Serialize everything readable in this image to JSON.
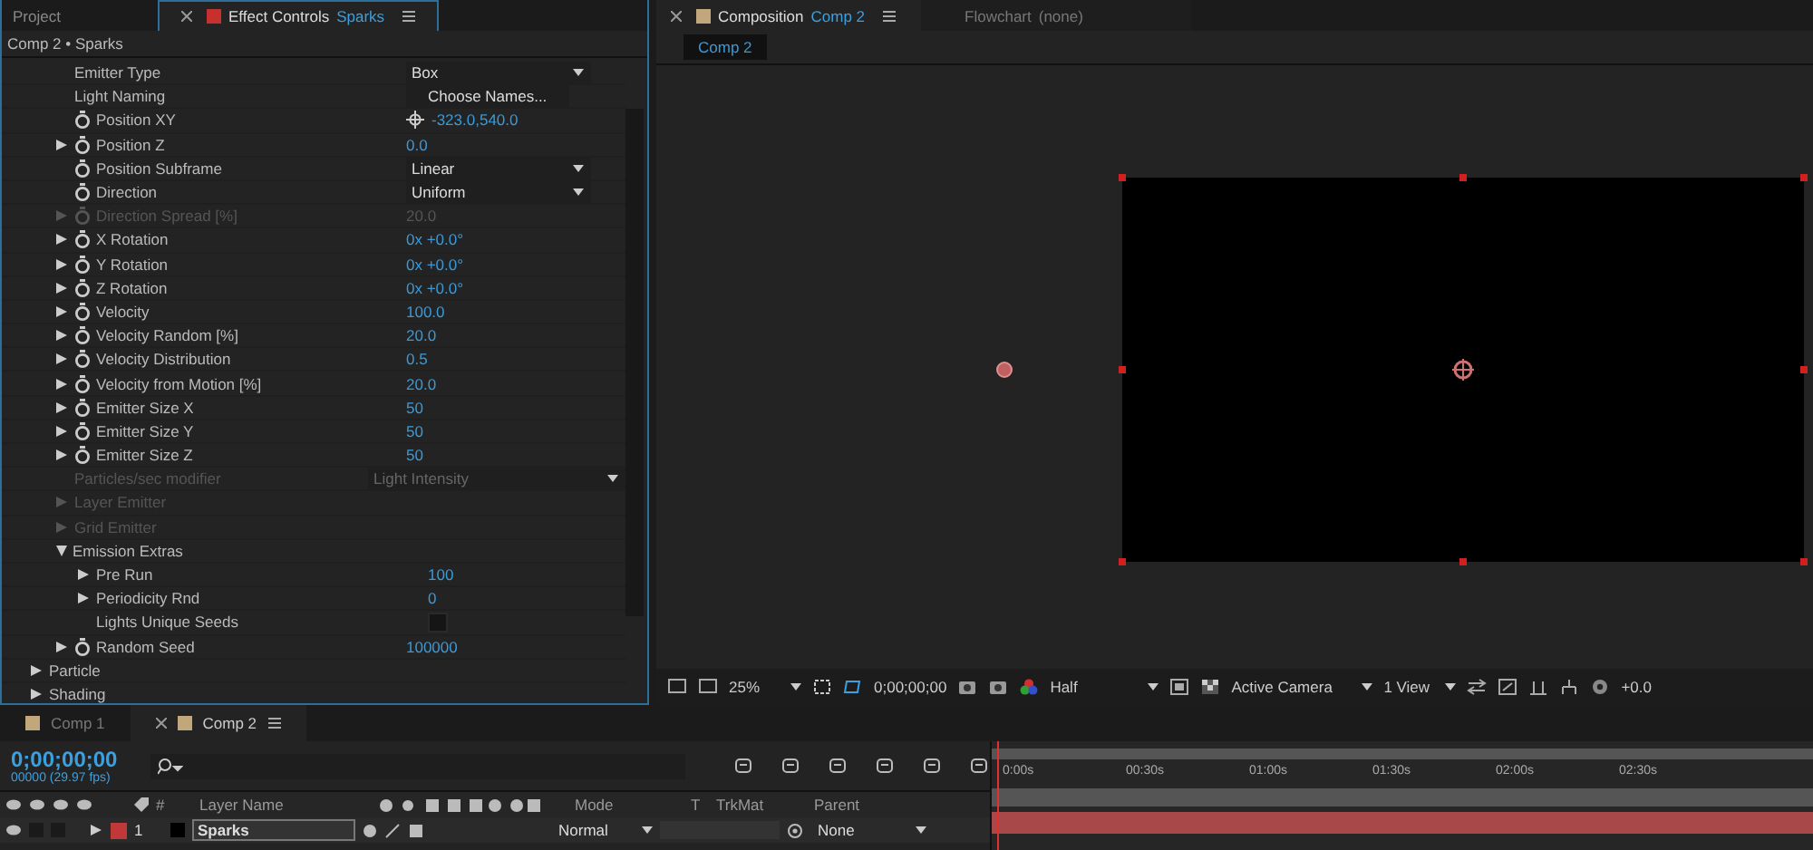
{
  "left_tabs": [
    {
      "label": "Project",
      "selected": false
    },
    {
      "label": "Effect Controls",
      "target": "Sparks",
      "selected": true
    }
  ],
  "breadcrumb": "Comp 2 • Sparks",
  "properties": [
    {
      "label": "Emitter Type",
      "stopwatch": false,
      "disabled": false,
      "kind": "dropdown",
      "value": "Box"
    },
    {
      "label": "Light Naming",
      "stopwatch": false,
      "disabled": false,
      "kind": "button",
      "value": "Choose Names..."
    },
    {
      "label": "Position XY",
      "stopwatch": true,
      "disabled": false,
      "kind": "point",
      "value": "-323.0,540.0"
    },
    {
      "label": "Position Z",
      "expanded": false,
      "stopwatch": true,
      "disabled": false,
      "kind": "number",
      "value": "0.0"
    },
    {
      "label": "Position Subframe",
      "stopwatch": true,
      "disabled": false,
      "kind": "dropdown",
      "value": "Linear"
    },
    {
      "label": "Direction",
      "stopwatch": true,
      "disabled": false,
      "kind": "dropdown",
      "value": "Uniform"
    },
    {
      "label": "Direction Spread [%]",
      "expanded": false,
      "stopwatch": true,
      "disabled": true,
      "kind": "number",
      "value": "20.0"
    },
    {
      "label": "X Rotation",
      "expanded": false,
      "stopwatch": true,
      "disabled": false,
      "kind": "number",
      "value": "0x +0.0°"
    },
    {
      "label": "Y Rotation",
      "expanded": false,
      "stopwatch": true,
      "disabled": false,
      "kind": "number",
      "value": "0x +0.0°"
    },
    {
      "label": "Z Rotation",
      "expanded": false,
      "stopwatch": true,
      "disabled": false,
      "kind": "number",
      "value": "0x +0.0°"
    },
    {
      "label": "Velocity",
      "expanded": false,
      "stopwatch": true,
      "disabled": false,
      "kind": "number",
      "value": "100.0"
    },
    {
      "label": "Velocity Random [%]",
      "expanded": false,
      "stopwatch": true,
      "disabled": false,
      "kind": "number",
      "value": "20.0"
    },
    {
      "label": "Velocity Distribution",
      "expanded": false,
      "stopwatch": true,
      "disabled": false,
      "kind": "number",
      "value": "0.5"
    },
    {
      "label": "Velocity from Motion [%]",
      "expanded": false,
      "stopwatch": true,
      "disabled": false,
      "kind": "number",
      "value": "20.0"
    },
    {
      "label": "Emitter Size X",
      "expanded": false,
      "stopwatch": true,
      "disabled": false,
      "kind": "number",
      "value": "50"
    },
    {
      "label": "Emitter Size Y",
      "expanded": false,
      "stopwatch": true,
      "disabled": false,
      "kind": "number",
      "value": "50"
    },
    {
      "label": "Emitter Size Z",
      "expanded": false,
      "stopwatch": true,
      "disabled": false,
      "kind": "number",
      "value": "50"
    },
    {
      "label": "Particles/sec modifier",
      "stopwatch": false,
      "disabled": true,
      "kind": "dropdown",
      "value": "Light Intensity"
    },
    {
      "label": "Layer Emitter",
      "expanded": false,
      "stopwatch": false,
      "disabled": true,
      "kind": "group"
    },
    {
      "label": "Grid Emitter",
      "expanded": false,
      "stopwatch": false,
      "disabled": true,
      "kind": "group"
    },
    {
      "label": "Emission Extras",
      "expanded": true,
      "stopwatch": false,
      "disabled": false,
      "kind": "group",
      "children": [
        {
          "label": "Pre Run",
          "expanded": false,
          "stopwatch": false,
          "disabled": false,
          "kind": "number",
          "value": "100"
        },
        {
          "label": "Periodicity Rnd",
          "expanded": false,
          "stopwatch": false,
          "disabled": false,
          "kind": "number",
          "value": "0"
        },
        {
          "label": "Lights Unique Seeds",
          "stopwatch": false,
          "disabled": false,
          "kind": "checkbox",
          "checked": false
        }
      ]
    },
    {
      "label": "Random Seed",
      "expanded": false,
      "stopwatch": true,
      "disabled": false,
      "kind": "number",
      "value": "100000"
    }
  ],
  "sections": [
    {
      "label": "Particle",
      "expanded": false
    },
    {
      "label": "Shading",
      "expanded": false
    }
  ],
  "right_tabs": [
    {
      "label": "Composition",
      "target": "Comp 2",
      "selected": true
    },
    {
      "label": "Flowchart",
      "target": "(none)",
      "selected": false
    }
  ],
  "viewer_tab": "Comp 2",
  "viewer_toolbar": {
    "zoom": "25%",
    "timecode": "0;00;00;00",
    "resolution": "Half",
    "camera": "Active Camera",
    "views": "1 View",
    "exposure": "+0.0"
  },
  "timeline": {
    "tabs": [
      {
        "label": "Comp 1",
        "selected": false
      },
      {
        "label": "Comp 2",
        "selected": true
      }
    ],
    "timecode": "0;00;00;00",
    "frames": "00000 (29.97 fps)",
    "columns": [
      "#",
      "Layer Name",
      "Mode",
      "T",
      "TrkMat",
      "Parent"
    ],
    "layers": [
      {
        "index": "1",
        "name": "Sparks",
        "color": "#c03838",
        "mode": "Normal",
        "parent": "None"
      }
    ],
    "ruler": [
      "0:00s",
      "00:30s",
      "01:00s",
      "01:30s",
      "02:00s",
      "02:30s"
    ]
  }
}
